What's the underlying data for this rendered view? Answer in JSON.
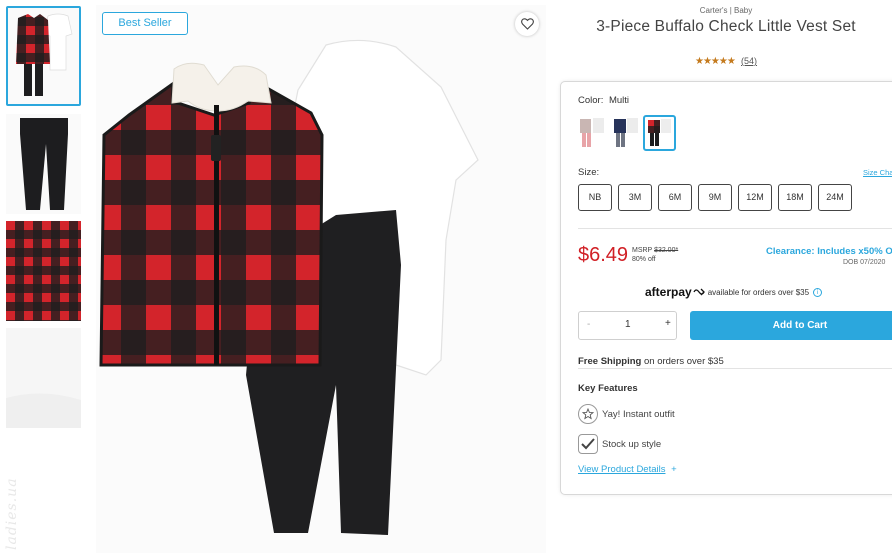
{
  "product": {
    "brand": "Carter's | Baby",
    "title": "3-Piece Buffalo Check Little Vest Set",
    "stars": "★★★★★",
    "review_count": "(54)",
    "badge": "Best Seller",
    "watermark": "ladies.ua"
  },
  "thumbnails": [
    {
      "name": "vest-set-full"
    },
    {
      "name": "black-pants"
    },
    {
      "name": "buffalo-check-detail"
    },
    {
      "name": "white-bodysuit-detail"
    }
  ],
  "color": {
    "label": "Color:",
    "value": "Multi",
    "swatches": [
      "pink-set",
      "navy-floral-set",
      "buffalo-check-set"
    ]
  },
  "size": {
    "label": "Size:",
    "chart_link": "Size Cha",
    "options": [
      "NB",
      "3M",
      "6M",
      "9M",
      "12M",
      "18M",
      "24M"
    ]
  },
  "pricing": {
    "price": "$6.49",
    "msrp_label": "MSRP",
    "msrp_value": "$32.00*",
    "discount": "80% off",
    "clearance": "Clearance: Includes x50% O",
    "dob": "DOB 07/2020"
  },
  "afterpay": {
    "logo": "afterpay",
    "text": "available for orders over $35",
    "info": "i"
  },
  "cart": {
    "minus": "-",
    "quantity": "1",
    "plus": "+",
    "add_label": "Add to Cart"
  },
  "shipping": {
    "bold": "Free Shipping",
    "rest": "on orders over $35"
  },
  "features": {
    "heading": "Key Features",
    "items": [
      "Yay! Instant outfit",
      "Stock up style"
    ],
    "details_link": "View Product Details",
    "details_plus": "+"
  },
  "colors": {
    "accent": "#2ba7dd",
    "price_red": "#d11f25",
    "plaid_red": "#d3242b",
    "plaid_black": "#1d1d1f"
  }
}
